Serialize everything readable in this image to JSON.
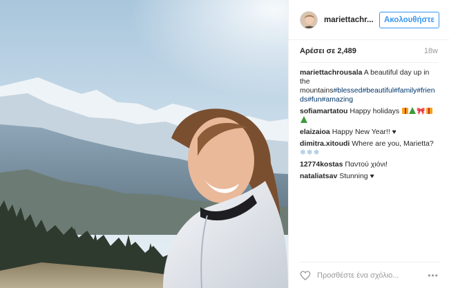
{
  "post": {
    "username": "mariettachr...",
    "follow_label": "Ακολουθήστε",
    "likes": "Αρέσει σε 2,489",
    "time": "18w"
  },
  "caption": {
    "user": "mariettachrousala",
    "text": " A beautiful day up in the mountains",
    "tags": [
      "#blessed",
      "#beautiful",
      "#family",
      "#friends",
      "#fun",
      "#amazing"
    ]
  },
  "comments": [
    {
      "user": "sofiamartatou",
      "text": " Happy holidays "
    },
    {
      "user": "elaizaioa",
      "text": " Happy New Year!! ",
      "emoji": "♥"
    },
    {
      "user": "dimitra.xitoudi",
      "text": " Where are you, Marietta? ",
      "emoji": "❄❄❄"
    },
    {
      "user": "12774kostas",
      "text": " Παντού χιόνι!"
    },
    {
      "user": "nataliatsav",
      "text": " Stunning ",
      "emoji": "♥"
    }
  ],
  "footer": {
    "comment_placeholder": "Προσθέστε ένα σχόλιο...",
    "more_label": "•••"
  },
  "icons": {
    "like": "heart-outline-icon",
    "more": "ellipsis-icon",
    "gift": "gift-emoji",
    "tree": "christmas-tree-emoji",
    "bow": "ribbon-emoji"
  },
  "colors": {
    "link": "#003569",
    "button": "#3897f0",
    "muted": "#999999",
    "text": "#262626"
  }
}
